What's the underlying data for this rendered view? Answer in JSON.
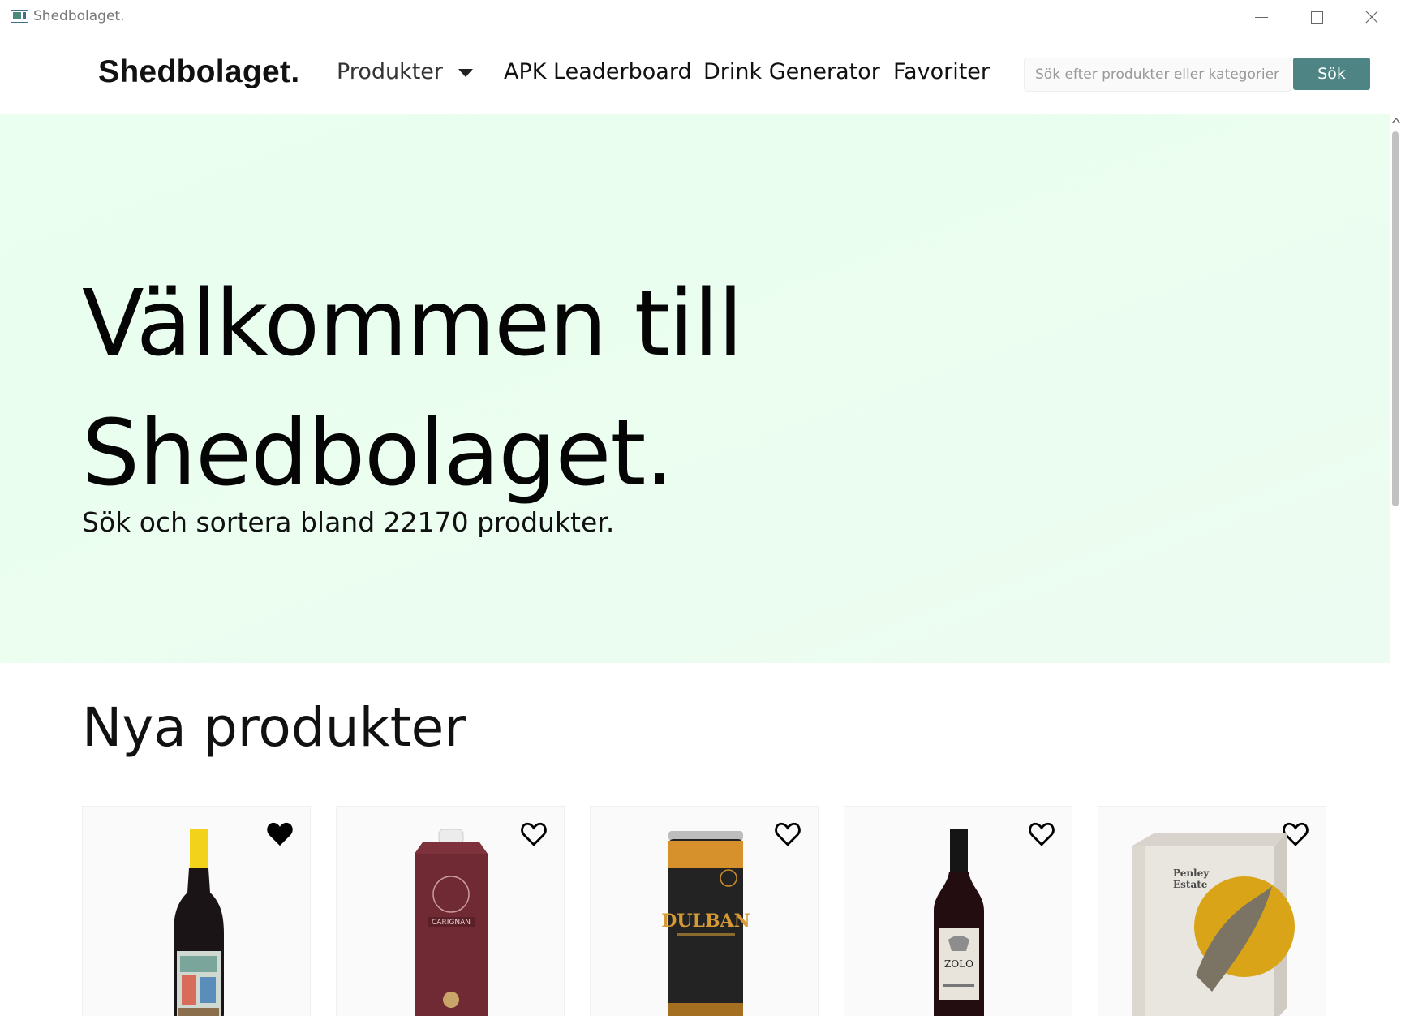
{
  "window": {
    "title": "Shedbolaget."
  },
  "navbar": {
    "brand": "Shedbolaget.",
    "items": [
      {
        "label": "Produkter",
        "has_dropdown": true
      },
      {
        "label": "APK Leaderboard"
      },
      {
        "label": "Drink Generator"
      },
      {
        "label": "Favoriter"
      }
    ],
    "search": {
      "placeholder": "Sök efter produkter eller kategorier",
      "value": "",
      "button_label": "Sök"
    }
  },
  "hero": {
    "title_line1": "Välkommen till",
    "title_line2": "Shedbolaget.",
    "subtitle": "Sök och sortera bland 22170 produkter."
  },
  "new_products": {
    "title": "Nya produkter",
    "products": [
      {
        "kind": "wine-bottle-yellow-cap",
        "favorited": true
      },
      {
        "kind": "wine-carton",
        "favorited": false,
        "label": "CARIGNAN"
      },
      {
        "kind": "can",
        "favorited": false,
        "label": "DULBAN"
      },
      {
        "kind": "wine-bottle-red",
        "favorited": false,
        "label": "ZOLO"
      },
      {
        "kind": "bag-in-box",
        "favorited": false,
        "label": "Penley Estate"
      }
    ]
  },
  "colors": {
    "hero_bg": "#eafff0",
    "search_button": "#4f8485",
    "heart": "#000000"
  }
}
